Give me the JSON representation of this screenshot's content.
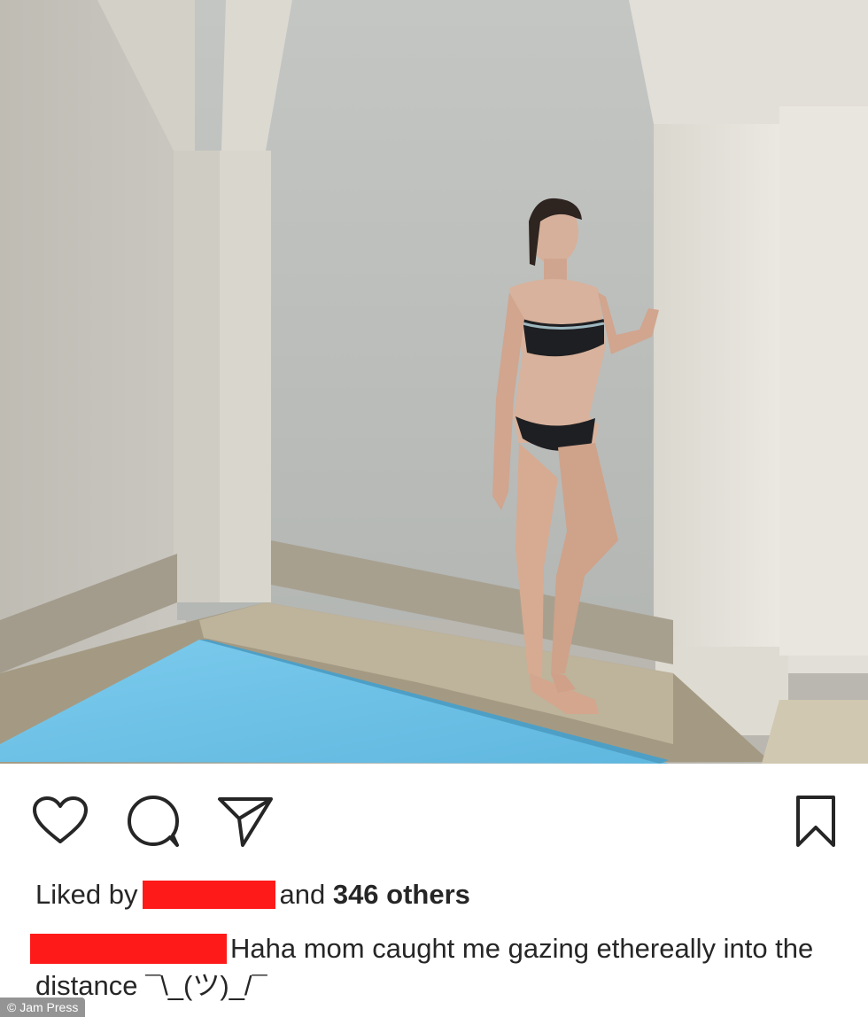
{
  "post": {
    "image_alt": "Woman in a black bikini standing by a stone pillar next to an indoor pool",
    "actions": {
      "like_icon": "heart-icon",
      "comment_icon": "comment-icon",
      "share_icon": "share-icon",
      "save_icon": "bookmark-icon"
    },
    "likes": {
      "prefix": "Liked by",
      "middle": "and",
      "count": "346 others"
    },
    "caption": {
      "text": "Haha mom caught me gazing ethereally into the distance ¯\\_(ツ)_/¯"
    },
    "watermark": "© Jam Press"
  },
  "colors": {
    "redaction": "#ff1a1a",
    "pool": "#6fc0e6",
    "text": "#262626"
  }
}
